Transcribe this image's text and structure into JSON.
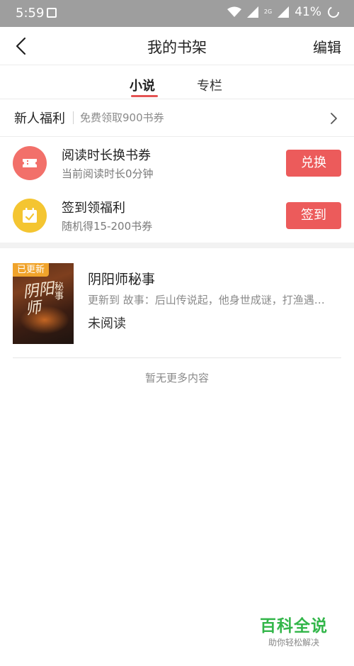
{
  "status_bar": {
    "time": "5:59",
    "network_label": "2G",
    "battery_percent": "41%"
  },
  "navbar": {
    "title": "我的书架",
    "edit_label": "编辑"
  },
  "tabs": [
    {
      "label": "小说",
      "active": true
    },
    {
      "label": "专栏",
      "active": false
    }
  ],
  "newcomer": {
    "label": "新人福利",
    "description": "免费领取900书券"
  },
  "rewards": [
    {
      "title": "阅读时长换书券",
      "subtitle": "当前阅读时长0分钟",
      "button": "兑换",
      "icon": "ticket-icon"
    },
    {
      "title": "签到领福利",
      "subtitle": "随机得15-200书券",
      "button": "签到",
      "icon": "calendar-check-icon"
    }
  ],
  "books": [
    {
      "title": "阴阳师秘事",
      "update_text": "更新到 故事：后山传说起，他身世成谜，打渔遇…",
      "status": "未阅读",
      "badge": "已更新",
      "cover_title": "阴阳师",
      "cover_subtitle": "秘事"
    }
  ],
  "no_more_text": "暂无更多内容",
  "watermark": {
    "title": "百科全说",
    "subtitle": "助你轻松解决"
  },
  "colors": {
    "accent_red": "#ec5b5b",
    "icon_red": "#f2706a",
    "icon_yellow": "#f4c531",
    "badge_orange": "#f0a32b",
    "watermark_green": "#33b64a"
  }
}
